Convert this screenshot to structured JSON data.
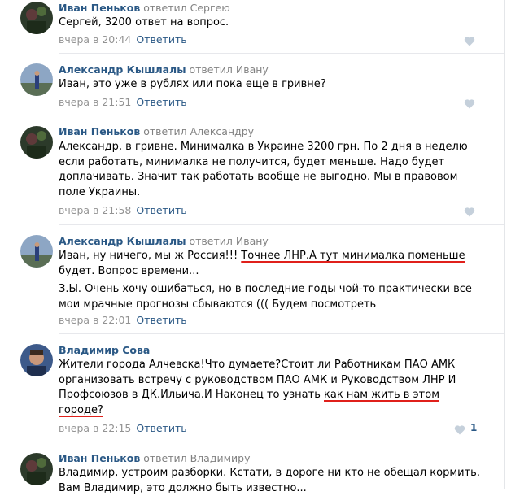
{
  "comments": [
    {
      "author": "Иван Пеньков",
      "reply_to": "ответил Сергею",
      "text": "Сергей, 3200 ответ на вопрос.",
      "date": "вчера в 20:44",
      "reply_label": "Ответить",
      "likes": ""
    },
    {
      "author": "Александр Кышлалы",
      "reply_to": "ответил Ивану",
      "text": "Иван, это уже в рублях или пока еще в гривне?",
      "date": "вчера в 21:51",
      "reply_label": "Ответить",
      "likes": ""
    },
    {
      "author": "Иван Пеньков",
      "reply_to": "ответил Александру",
      "text_lines": [
        "Александр, в гривне. Минималка в Украине 3200 грн. По 2 дня в неделю",
        "если работать, минималка не получится, будет меньше. Надо будет",
        "доплачивать. Значит так работать вообще не выгодно. Мы в правовом",
        "поле Украины."
      ],
      "date": "вчера в 21:58",
      "reply_label": "Ответить",
      "likes": ""
    },
    {
      "author": "Александр Кышлалы",
      "reply_to": "ответил Ивану",
      "text_a": "Иван, ну ничего, мы ж Россия!!! ",
      "text_b": "Точнее ЛНР.А тут минималка поменьше",
      "text_c": "будет. Вопрос времени...",
      "text_d": "З.Ы. Очень хочу ошибаться, но в последние годы чой-то практически все",
      "text_e": "мои мрачные прогнозы сбываются ((( Будем посмотреть",
      "date": "вчера в 22:01",
      "reply_label": "Ответить",
      "likes": ""
    },
    {
      "author": "Владимир Сова",
      "reply_to": "",
      "text_l1": "Жители города Алчевска!Что думаете?Стоит ли Работникам ПАО АМК",
      "text_l2": "организовать встречу с руководством ПАО АМК и Руководством ЛНР И",
      "text_l3a": "Профсоюзов в ДК.Ильича.И Наконец то узнать ",
      "text_l3b": "как нам жить в этом",
      "text_l4": "городе?",
      "date": "вчера в 22:15",
      "reply_label": "Ответить",
      "likes": "1"
    },
    {
      "author": "Иван Пеньков",
      "reply_to": "ответил Владимиру",
      "text_l1": "Владимир, устроим разборки. Кстати, в дороге ни кто не обещал кормить.",
      "text_l2": "Вам Владимир, это должно быть известно...",
      "date": "",
      "reply_label": "",
      "likes": ""
    }
  ],
  "colors": {
    "link": "#2a5885",
    "meta": "#939393",
    "highlight": "#e0201b"
  }
}
